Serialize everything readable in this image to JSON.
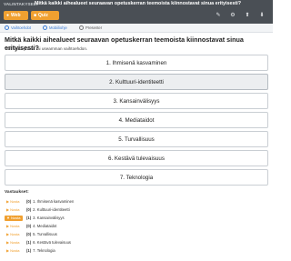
{
  "header": {
    "section_label": "VALINTAKYSELY",
    "question_title": "Mitkä kaikki aihealueet seuraavan opetuskerran teemoista kiinnostavat sinua erityisesti?",
    "web_button": "Web",
    "cast_button": "Quiz",
    "tool_icons": [
      "edit-icon",
      "settings-icon",
      "up-icon",
      "down-icon"
    ]
  },
  "subnav": {
    "tabs": [
      "Vaihtoehdot",
      "Mobiiliohje",
      "Presenter"
    ]
  },
  "main": {
    "question": "Mitkä kaikki aihealueet seuraavan opetuskerran teemoista kiinnostavat sinua erityisesti?",
    "hint": "Voit valita yhden tai useamman vaihtoehdon.",
    "options": [
      {
        "label": "1. Ihmisenä kasvaminen",
        "selected": false
      },
      {
        "label": "2. Kulttuuri-identiteetti",
        "selected": true
      },
      {
        "label": "3. Kansainvälisyys",
        "selected": false
      },
      {
        "label": "4. Mediataidot",
        "selected": false
      },
      {
        "label": "5. Turvallisuus",
        "selected": false
      },
      {
        "label": "6. Kestävä tulevaisuus",
        "selected": false
      },
      {
        "label": "7. Teknologia",
        "selected": false
      }
    ]
  },
  "answers": {
    "title": "Vastaukset:",
    "button_label": "Nosta",
    "items": [
      {
        "count": "(0)",
        "label": "1. Ihmisenä kasvaminen",
        "selected": false
      },
      {
        "count": "(0)",
        "label": "2. Kulttuuri-identiteetti",
        "selected": false
      },
      {
        "count": "(1)",
        "label": "3. Kansainvälisyys",
        "selected": true
      },
      {
        "count": "(0)",
        "label": "4. Mediataidot",
        "selected": false
      },
      {
        "count": "(0)",
        "label": "5. Turvallisuus",
        "selected": false
      },
      {
        "count": "(1)",
        "label": "6. Kestävä tulevaisuus",
        "selected": false
      },
      {
        "count": "(1)",
        "label": "7. Teknologia",
        "selected": false
      }
    ]
  },
  "colors": {
    "accent": "#f0a030",
    "topbar": "#4a4f55",
    "link": "#3a7bd5"
  }
}
